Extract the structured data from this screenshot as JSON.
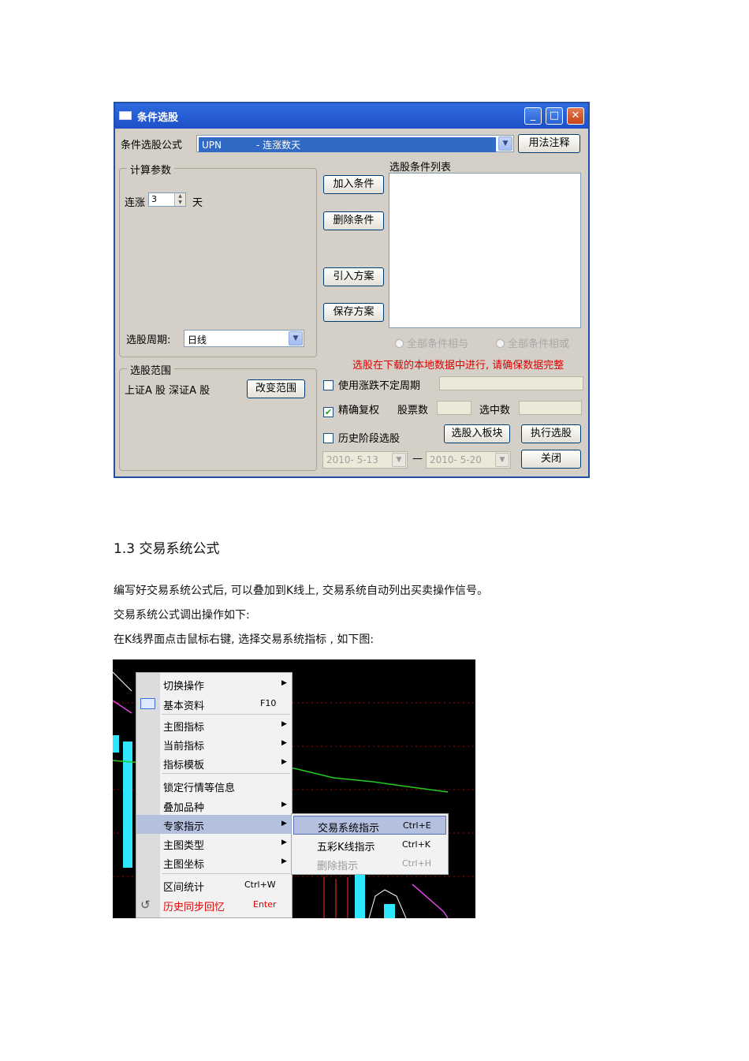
{
  "dialog": {
    "title": "条件选股",
    "title_buttons": [
      "_",
      "□",
      "✕"
    ],
    "formula_label": "条件选股公式",
    "formula_code": "UPN",
    "formula_desc": "- 连涨数天",
    "usage_button": "用法注释",
    "calc_group_title": "计算参数",
    "param_label": "连涨",
    "param_value": "3",
    "param_unit": "天",
    "add_button": "加入条件",
    "delete_button": "删除条件",
    "import_button": "引入方案",
    "save_button": "保存方案",
    "list_title": "选股条件列表",
    "period_label": "选股周期:",
    "period_value": "日线",
    "radio_and": "全部条件相与",
    "radio_or": "全部条件相或",
    "warning": "选股在下载的本地数据中进行, 请确保数据完整",
    "range_group_title": "选股范围",
    "range_text": "上证A 股  深证A 股",
    "change_range_button": "改变范围",
    "use_uncertain_period": "使用涨跌不定周期",
    "precise_adjust": "精确复权",
    "precise_adjust_checked": "✔",
    "stock_count_label": "股票数",
    "selected_count_label": "选中数",
    "history_stage": "历史阶段选股",
    "to_block_button": "选股入板块",
    "execute_button": "执行选股",
    "date_from": "2010- 5-13",
    "date_dash": "—",
    "date_to": "2010- 5-20",
    "close_button": "关闭"
  },
  "section": {
    "heading": "1.3 交易系统公式",
    "para1": "编写好交易系统公式后, 可以叠加到K线上, 交易系统自动列出买卖操作信号。",
    "para2": "交易系统公式调出操作如下:",
    "para3": "在K线界面点击鼠标右键, 选择交易系统指标        , 如下图:"
  },
  "context_menu": {
    "items": [
      {
        "label": "切换操作",
        "shortcut": "",
        "arrow": "▶"
      },
      {
        "label": "基本资料",
        "shortcut": "F10",
        "arrow": ""
      },
      {
        "label": "主图指标",
        "shortcut": "",
        "arrow": "▶"
      },
      {
        "label": "当前指标",
        "shortcut": "",
        "arrow": "▶"
      },
      {
        "label": "指标模板",
        "shortcut": "",
        "arrow": "▶"
      },
      {
        "label": "锁定行情等信息",
        "shortcut": "",
        "arrow": ""
      },
      {
        "label": "叠加品种",
        "shortcut": "",
        "arrow": "▶"
      },
      {
        "label": "专家指示",
        "shortcut": "",
        "arrow": "▶"
      },
      {
        "label": "主图类型",
        "shortcut": "",
        "arrow": "▶"
      },
      {
        "label": "主图坐标",
        "shortcut": "",
        "arrow": "▶"
      },
      {
        "label": "区间统计",
        "shortcut": "Ctrl+W",
        "arrow": ""
      },
      {
        "label": "历史同步回忆",
        "shortcut": "Enter",
        "arrow": ""
      }
    ],
    "submenu": [
      {
        "label": "交易系统指示",
        "shortcut": "Ctrl+E"
      },
      {
        "label": "五彩K线指示",
        "shortcut": "Ctrl+K"
      },
      {
        "label": "删除指示",
        "shortcut": "Ctrl+H"
      }
    ],
    "colors": {
      "highlight": "#b3c0e0",
      "red_item": "#e00000",
      "chart_bg": "#000000",
      "cyan_bar": "#2ee6ff"
    }
  }
}
